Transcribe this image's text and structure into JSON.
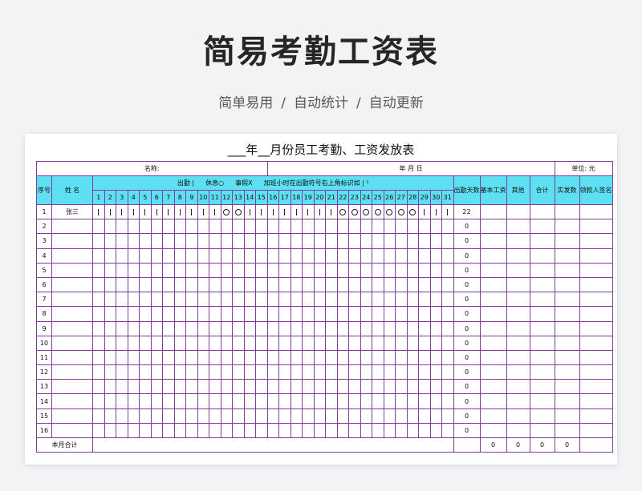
{
  "page": {
    "title": "简易考勤工资表",
    "subtitle_items": [
      "简单易用",
      "自动统计",
      "自动更新"
    ],
    "subtitle_sep": "/"
  },
  "sheet": {
    "title": "___年__月份员工考勤、工资发放表",
    "name_label": "名称:",
    "date_label": "年    月    日",
    "unit_label": "单位:  元",
    "headers": {
      "seq": "序号",
      "name": "姓  名",
      "legend": {
        "present": "出勤 |",
        "rest": "休息○",
        "leave": "事假X",
        "overtime": "加班小时在出勤符号右上角标识如 | ²"
      },
      "days_worked": "出勤天数",
      "base_salary": "基本工资",
      "other": "其他",
      "total": "合计",
      "actual_pay": "实发数",
      "signature": "领款人签名"
    },
    "days": [
      "1",
      "2",
      "3",
      "4",
      "5",
      "6",
      "7",
      "8",
      "9",
      "10",
      "11",
      "12",
      "13",
      "14",
      "15",
      "16",
      "17",
      "18",
      "19",
      "20",
      "21",
      "22",
      "23",
      "24",
      "25",
      "26",
      "27",
      "28",
      "29",
      "30",
      "31"
    ],
    "rows": [
      {
        "seq": "1",
        "name": "张三",
        "marks": [
          "|",
          "|",
          "|",
          "|",
          "|",
          "|",
          "|",
          "|",
          "|",
          "|",
          "|",
          "○",
          "○",
          "|",
          "|",
          "|",
          "|",
          "|",
          "|",
          "|",
          "|",
          "○",
          "○",
          "○",
          "○",
          "○",
          "○",
          "○",
          "|",
          "|",
          "|"
        ],
        "days_worked": "22"
      },
      {
        "seq": "2",
        "name": "",
        "marks": [],
        "days_worked": "0"
      },
      {
        "seq": "3",
        "name": "",
        "marks": [],
        "days_worked": "0"
      },
      {
        "seq": "4",
        "name": "",
        "marks": [],
        "days_worked": "0"
      },
      {
        "seq": "5",
        "name": "",
        "marks": [],
        "days_worked": "0"
      },
      {
        "seq": "6",
        "name": "",
        "marks": [],
        "days_worked": "0"
      },
      {
        "seq": "7",
        "name": "",
        "marks": [],
        "days_worked": "0"
      },
      {
        "seq": "8",
        "name": "",
        "marks": [],
        "days_worked": "0"
      },
      {
        "seq": "9",
        "name": "",
        "marks": [],
        "days_worked": "0"
      },
      {
        "seq": "10",
        "name": "",
        "marks": [],
        "days_worked": "0"
      },
      {
        "seq": "11",
        "name": "",
        "marks": [],
        "days_worked": "0"
      },
      {
        "seq": "12",
        "name": "",
        "marks": [],
        "days_worked": "0"
      },
      {
        "seq": "13",
        "name": "",
        "marks": [],
        "days_worked": "0"
      },
      {
        "seq": "14",
        "name": "",
        "marks": [],
        "days_worked": "0"
      },
      {
        "seq": "15",
        "name": "",
        "marks": [],
        "days_worked": "0"
      },
      {
        "seq": "16",
        "name": "",
        "marks": [],
        "days_worked": "0"
      }
    ],
    "footer": {
      "label": "本月合计",
      "base_salary": "0",
      "other": "0",
      "total": "0",
      "actual_pay": "0"
    },
    "colors": {
      "header_fill": "#5ee0f2",
      "border": "#7e3f9c"
    }
  }
}
